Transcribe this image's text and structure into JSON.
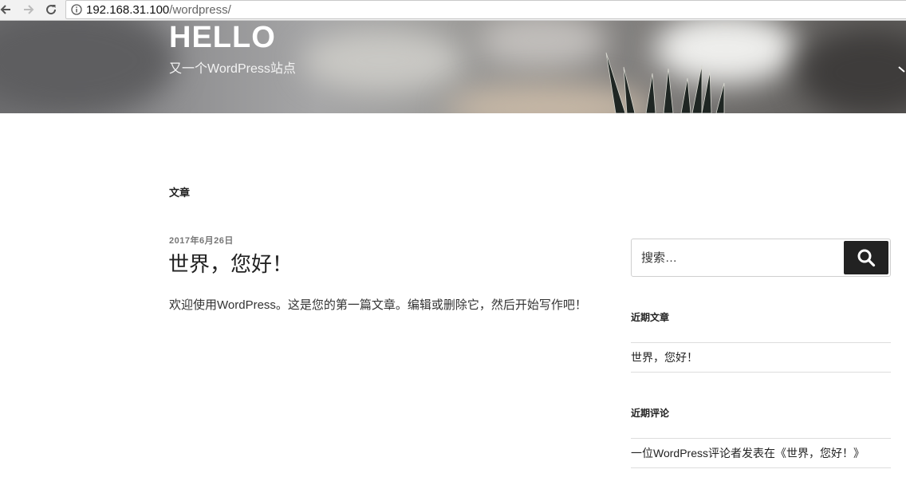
{
  "browser": {
    "url_host": "192.168.31.100",
    "url_path": "/wordpress/"
  },
  "header": {
    "site_title": "HELLO",
    "site_description": "又一个WordPress站点"
  },
  "content": {
    "page_header": "文章",
    "posts": [
      {
        "date": "2017年6月26日",
        "title": "世界，您好！",
        "excerpt": "欢迎使用WordPress。这是您的第一篇文章。编辑或删除它，然后开始写作吧！"
      }
    ]
  },
  "sidebar": {
    "search": {
      "placeholder": "搜索…"
    },
    "recent_posts": {
      "title": "近期文章",
      "items": [
        "世界，您好！"
      ]
    },
    "recent_comments": {
      "title": "近期评论",
      "items": [
        "一位WordPress评论者发表在《世界，您好！》"
      ]
    }
  },
  "colors": {
    "accent_dark": "#222222",
    "meta_gray": "#767676"
  }
}
